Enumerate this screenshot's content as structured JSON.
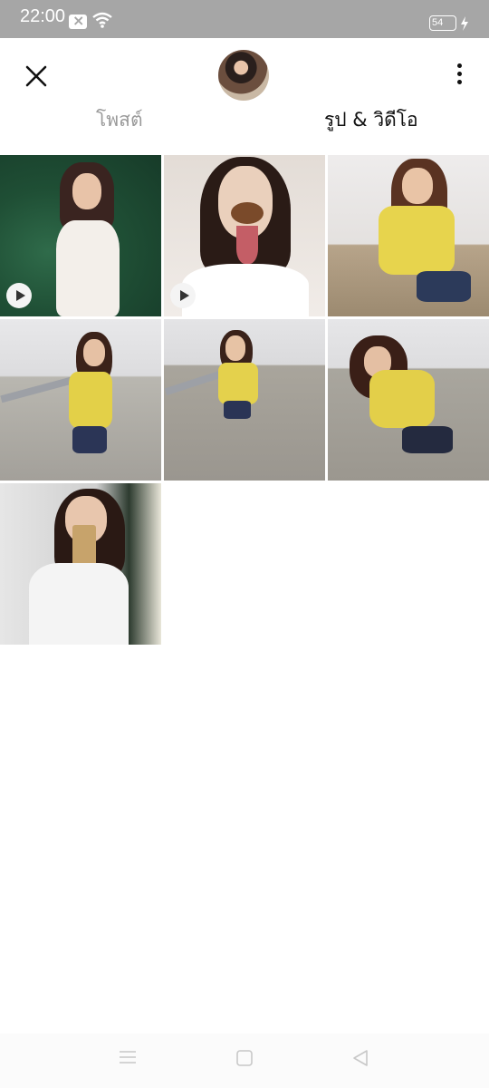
{
  "status_bar": {
    "time": "22:00",
    "battery_level": "54",
    "icons": [
      "notification-x-icon",
      "wifi-icon",
      "battery-icon",
      "charging-bolt-icon"
    ]
  },
  "header": {
    "close_icon": "close-icon",
    "more_icon": "more-vertical-icon",
    "tabs": [
      {
        "label": "โพสต์",
        "active": false
      },
      {
        "label": "รูป & วิดีโอ",
        "active": true
      }
    ]
  },
  "gallery": {
    "items": [
      {
        "type": "video",
        "description": "girl-in-white-top-green-background"
      },
      {
        "type": "video",
        "description": "girl-with-dog-filter"
      },
      {
        "type": "photo",
        "description": "girl-yellow-shirt-roadside"
      },
      {
        "type": "photo",
        "description": "girl-yellow-shirt-road"
      },
      {
        "type": "photo",
        "description": "girl-yellow-shirt-walking"
      },
      {
        "type": "photo",
        "description": "girl-yellow-shirt-posing"
      },
      {
        "type": "photo",
        "description": "girl-mirror-selfie"
      }
    ]
  },
  "colors": {
    "status_bar": "#a6a6a6",
    "active_tab": "#111111",
    "inactive_tab": "#9a9a9a",
    "play_badge": "#f4f4f4"
  },
  "nav_bar": {
    "icons": [
      "menu-icon",
      "home-icon",
      "back-icon"
    ]
  }
}
